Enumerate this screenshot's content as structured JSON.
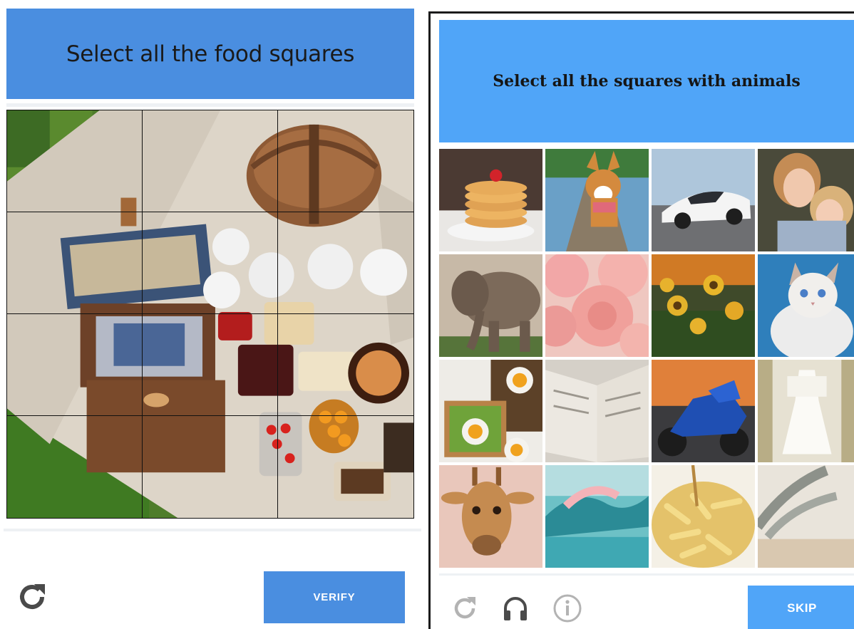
{
  "food_captcha": {
    "prompt": "Select all the food squares",
    "verify_label": "VERIFY",
    "grid": {
      "rows": 4,
      "cols": 3
    },
    "icons": {
      "refresh": "refresh-icon"
    },
    "colors": {
      "header": "#4a8ee0",
      "button": "#4a8ee0"
    }
  },
  "animal_captcha": {
    "prompt": "Select all the squares with animals",
    "skip_label": "SKIP",
    "grid": {
      "rows": 4,
      "cols": 4
    },
    "tiles": [
      "pancakes-image",
      "corgi-image",
      "car-image",
      "children-image",
      "elephant-image",
      "peonies-image",
      "sunflowers-image",
      "cat-image",
      "avocado-toast-image",
      "open-book-image",
      "motorcycle-image",
      "white-dress-image",
      "giraffe-image",
      "ocean-wave-image",
      "pasta-image",
      "palm-shadow-image"
    ],
    "icons": {
      "refresh": "refresh-icon",
      "audio": "headphones-icon",
      "info": "info-icon"
    },
    "colors": {
      "header": "#50a5f8",
      "button": "#50a5f8"
    }
  }
}
